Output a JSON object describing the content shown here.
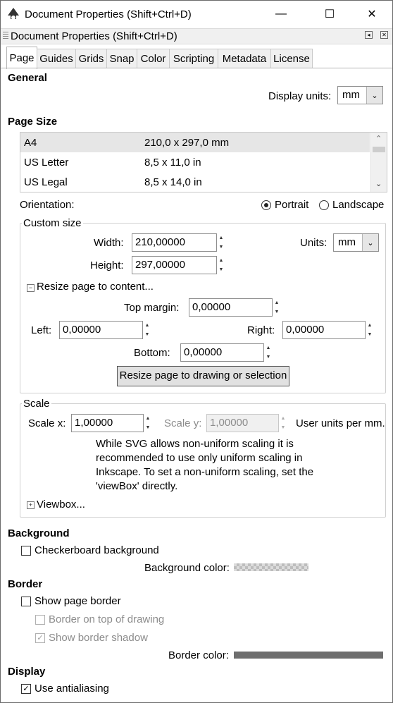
{
  "window": {
    "title": "Document Properties (Shift+Ctrl+D)",
    "docked_title": "Document Properties (Shift+Ctrl+D)",
    "minimize": "—",
    "maximize": "☐",
    "close": "✕"
  },
  "tabs": [
    "Page",
    "Guides",
    "Grids",
    "Snap",
    "Color",
    "Scripting",
    "Metadata",
    "License"
  ],
  "general": {
    "heading": "General",
    "display_units_label": "Display units:",
    "display_units_value": "mm"
  },
  "page_size": {
    "heading": "Page Size",
    "rows": [
      {
        "name": "A4",
        "size": "210,0 x 297,0 mm"
      },
      {
        "name": "US Letter",
        "size": "8,5 x 11,0 in"
      },
      {
        "name": "US Legal",
        "size": "8,5 x 14,0 in"
      }
    ],
    "orientation_label": "Orientation:",
    "portrait": "Portrait",
    "landscape": "Landscape"
  },
  "custom_size": {
    "title": "Custom size",
    "width_label": "Width:",
    "width_value": "210,00000",
    "height_label": "Height:",
    "height_value": "297,00000",
    "units_label": "Units:",
    "units_value": "mm",
    "resize_expander": "Resize page to content...",
    "top_margin_label": "Top margin:",
    "top_margin_value": "0,00000",
    "left_label": "Left:",
    "left_value": "0,00000",
    "right_label": "Right:",
    "right_value": "0,00000",
    "bottom_label": "Bottom:",
    "bottom_value": "0,00000",
    "resize_button": "Resize page to drawing or selection"
  },
  "scale": {
    "title": "Scale",
    "scale_x_label": "Scale x:",
    "scale_x_value": "1,00000",
    "scale_y_label": "Scale y:",
    "scale_y_value": "1,00000",
    "units_text": "User units per mm.",
    "note_lines": [
      "While SVG allows non-uniform scaling it is",
      "recommended to use only uniform scaling in",
      "Inkscape. To set a non-uniform scaling, set the",
      "'viewBox' directly."
    ],
    "viewbox_expander": "Viewbox..."
  },
  "background": {
    "heading": "Background",
    "checkerboard": "Checkerboard background",
    "color_label": "Background color:"
  },
  "border": {
    "heading": "Border",
    "show_border": "Show page border",
    "border_on_top": "Border on top of drawing",
    "show_shadow": "Show border shadow",
    "color_label": "Border color:",
    "color": "#6e6e6e"
  },
  "display": {
    "heading": "Display",
    "antialiasing": "Use antialiasing"
  },
  "icons": {
    "check": "✓",
    "up": "▲",
    "down": "▼",
    "minus": "−",
    "plus": "+",
    "chevron_down": "⌄",
    "chevron_up": "⌃"
  }
}
